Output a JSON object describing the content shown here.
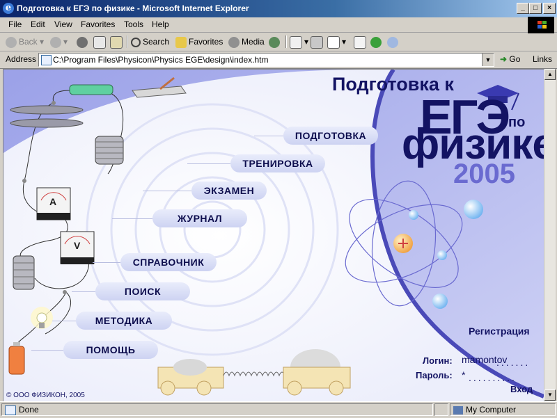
{
  "window": {
    "title": "Подготовка к ЕГЭ по физике - Microsoft Internet Explorer",
    "app_icon": "ie-icon",
    "controls": {
      "minimize": "_",
      "maximize": "□",
      "close": "×"
    }
  },
  "menu": {
    "items": [
      "File",
      "Edit",
      "View",
      "Favorites",
      "Tools",
      "Help"
    ]
  },
  "toolbar": {
    "back": "Back",
    "search": "Search",
    "favorites": "Favorites",
    "media": "Media"
  },
  "address": {
    "label": "Address",
    "value": "C:\\Program Files\\Physicon\\Physics EGE\\design\\index.htm",
    "go": "Go",
    "links": "Links"
  },
  "page": {
    "title_line1": "Подготовка к",
    "title_ege": "ЕГЭ",
    "title_po": "по",
    "title_physics": "физике",
    "year": "2005",
    "nav": {
      "prep": "ПОДГОТОВКА",
      "training": "ТРЕНИРОВКА",
      "exam": "ЭКЗАМЕН",
      "journal": "ЖУРНАЛ",
      "reference": "СПРАВОЧНИК",
      "search": "ПОИСК",
      "method": "МЕТОДИКА",
      "help": "ПОМОЩЬ"
    },
    "auth": {
      "register": "Регистрация",
      "login_label": "Логин:",
      "login_value": "mamontov",
      "password_label": "Пароль:",
      "password_value": "*",
      "enter": "Вход"
    },
    "copyright": "© ООО ФИЗИКОН, 2005",
    "meter_a": "A",
    "meter_v": "V",
    "colors": {
      "dark_blue": "#131363",
      "accent": "#6a6ad0",
      "swoosh": "#4a4ab8"
    }
  },
  "status": {
    "text": "Done",
    "zone": "My Computer"
  }
}
